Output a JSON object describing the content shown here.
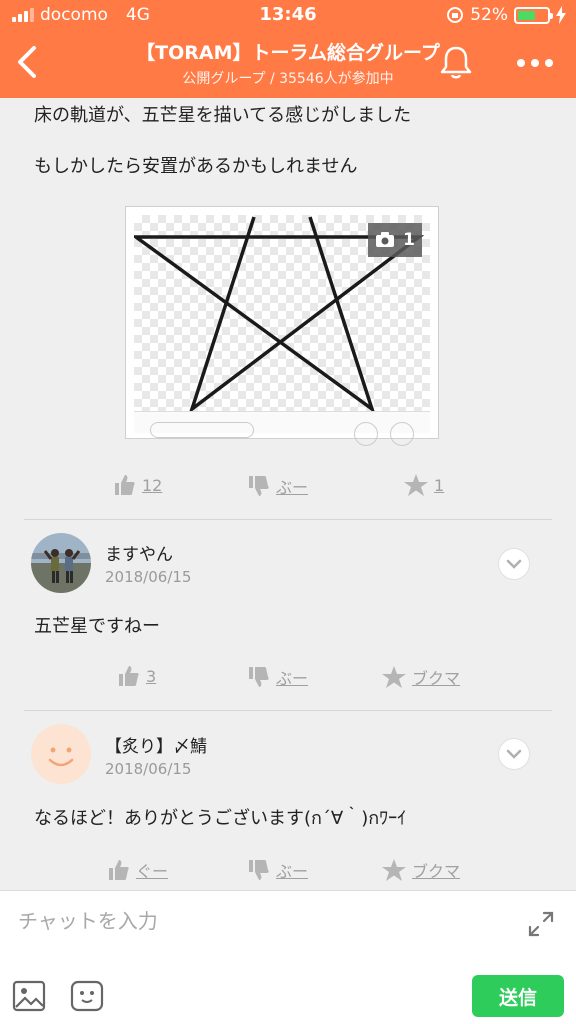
{
  "status_bar": {
    "carrier": "docomo",
    "network": "4G",
    "time": "13:46",
    "battery": "52%",
    "battery_level": 0.52
  },
  "header": {
    "title": "【TORAM】トーラム総合グループ",
    "subtitle": "公開グループ / 35546人が参加中",
    "back_icon": "chevron-left-icon",
    "bell_icon": "bell-icon",
    "more_icon": "more-dots-icon"
  },
  "post": {
    "lines": [
      "床の軌道が、五芒星を描いてる感じがしました",
      "もしかしたら安置があるかもしれません"
    ],
    "image": {
      "photo_count": "1"
    },
    "reactions": {
      "like": "12",
      "dislike": "ぶー",
      "star": "1"
    }
  },
  "comments": [
    {
      "name": "ますやん",
      "date": "2018/06/15",
      "body": "五芒星ですねー",
      "reactions": {
        "like": "3",
        "dislike": "ぶー",
        "bookmark": "ブクマ"
      }
    },
    {
      "name": "【炙り】〆鯖",
      "date": "2018/06/15",
      "body": "なるほど！ありがとうございます(ก´∀｀)กﾜｰｲ",
      "reactions": {
        "like": "ぐー",
        "dislike": "ぶー",
        "bookmark": "ブクマ"
      }
    }
  ],
  "input": {
    "placeholder": "チャットを入力",
    "send_label": "送信"
  },
  "colors": {
    "header_bg": "#ff7a45",
    "send_bg": "#2ecc5b",
    "reaction_gray": "#a0a0a0"
  }
}
